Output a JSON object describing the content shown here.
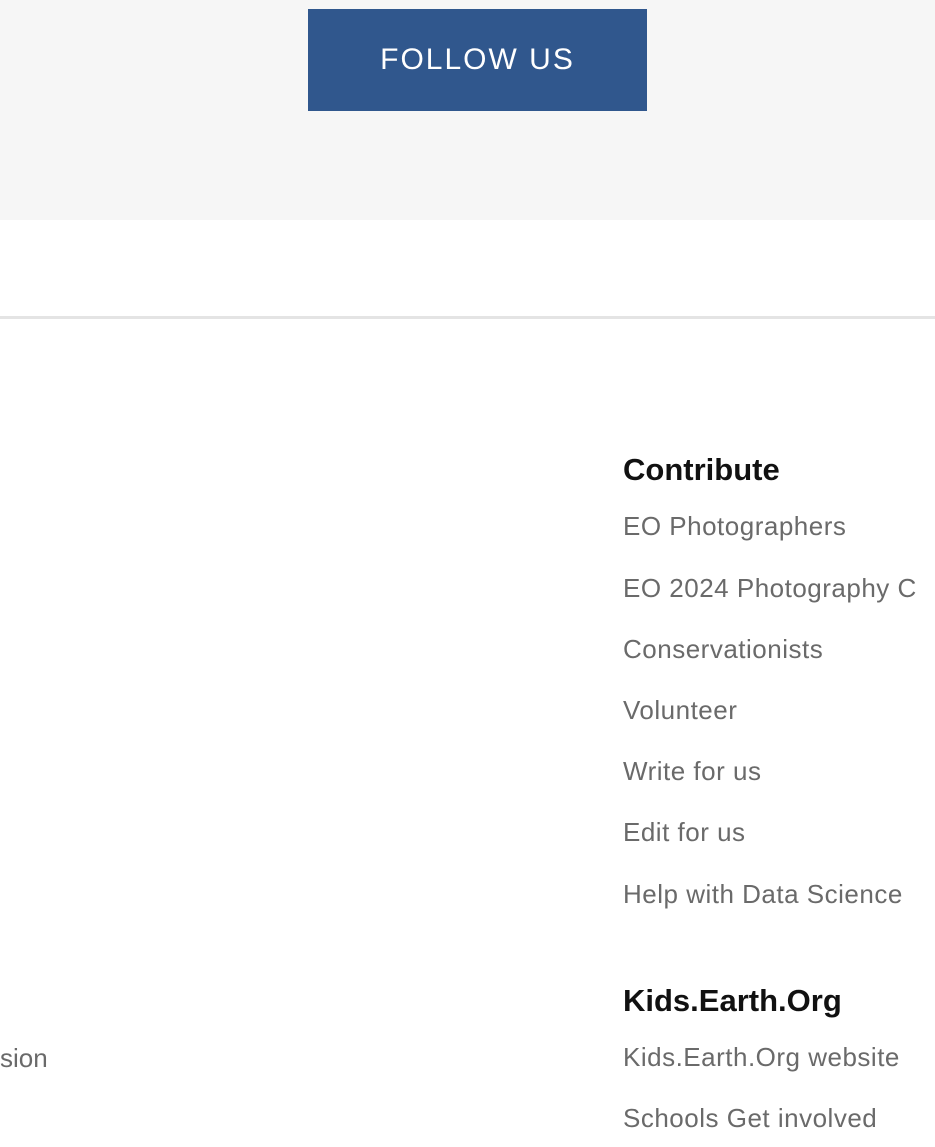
{
  "follow": {
    "label": "FOLLOW US"
  },
  "contribute": {
    "heading": "Contribute",
    "links": [
      "EO Photographers",
      "EO 2024 Photography C",
      "Conservationists",
      "Volunteer",
      "Write for us",
      "Edit for us",
      "Help with Data Science"
    ]
  },
  "kids": {
    "heading": "Kids.Earth.Org",
    "links": [
      "Kids.Earth.Org website",
      "Schools Get involved"
    ]
  },
  "left_column": {
    "clipped_link": "sion"
  },
  "colors": {
    "button_bg": "#30578d",
    "band_bg": "#f6f6f6",
    "link_text": "#6a6a6a",
    "heading_text": "#111111"
  }
}
